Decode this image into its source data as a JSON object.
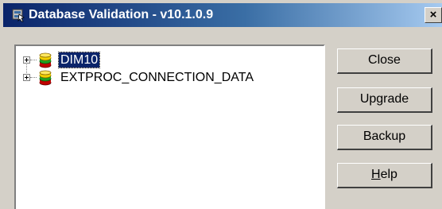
{
  "window": {
    "title": "Database Validation - v10.1.0.9",
    "close_glyph": "×"
  },
  "tree": {
    "nodes": [
      {
        "label": "DIM10",
        "selected": true,
        "icon": "database-icon"
      },
      {
        "label": "EXTPROC_CONNECTION_DATA",
        "selected": false,
        "icon": "database-icon"
      }
    ]
  },
  "buttons": {
    "close_label": "Close",
    "upgrade_label": "Upgrade",
    "backup_label": "Backup",
    "help_label": "Help"
  },
  "colors": {
    "titlebar_start": "#0a246a",
    "titlebar_end": "#a6caf0",
    "selection": "#0a246a",
    "face": "#d4d0c8"
  }
}
